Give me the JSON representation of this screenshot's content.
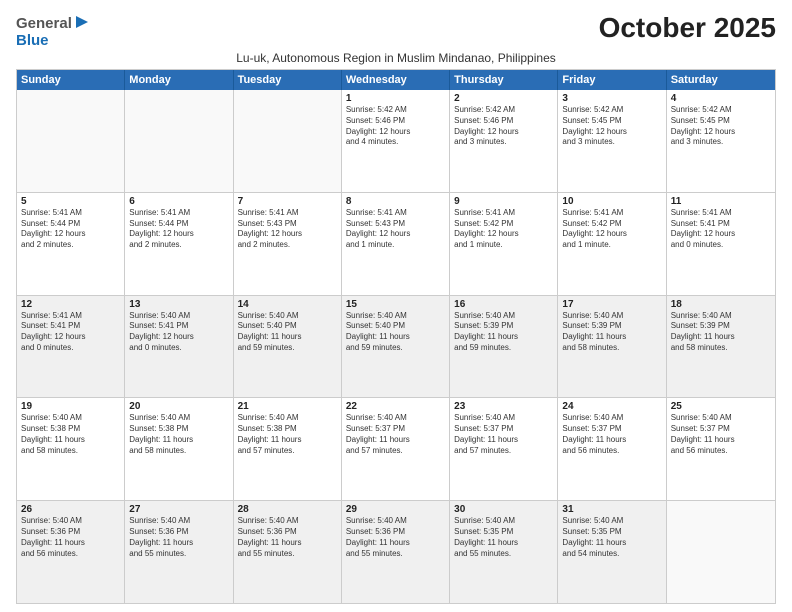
{
  "logo": {
    "general": "General",
    "blue": "Blue"
  },
  "title": "October 2025",
  "subtitle": "Lu-uk, Autonomous Region in Muslim Mindanao, Philippines",
  "days": [
    "Sunday",
    "Monday",
    "Tuesday",
    "Wednesday",
    "Thursday",
    "Friday",
    "Saturday"
  ],
  "rows": [
    [
      {
        "day": "",
        "lines": [],
        "empty": true
      },
      {
        "day": "",
        "lines": [],
        "empty": true
      },
      {
        "day": "",
        "lines": [],
        "empty": true
      },
      {
        "day": "1",
        "lines": [
          "Sunrise: 5:42 AM",
          "Sunset: 5:46 PM",
          "Daylight: 12 hours",
          "and 4 minutes."
        ]
      },
      {
        "day": "2",
        "lines": [
          "Sunrise: 5:42 AM",
          "Sunset: 5:46 PM",
          "Daylight: 12 hours",
          "and 3 minutes."
        ]
      },
      {
        "day": "3",
        "lines": [
          "Sunrise: 5:42 AM",
          "Sunset: 5:45 PM",
          "Daylight: 12 hours",
          "and 3 minutes."
        ]
      },
      {
        "day": "4",
        "lines": [
          "Sunrise: 5:42 AM",
          "Sunset: 5:45 PM",
          "Daylight: 12 hours",
          "and 3 minutes."
        ]
      }
    ],
    [
      {
        "day": "5",
        "lines": [
          "Sunrise: 5:41 AM",
          "Sunset: 5:44 PM",
          "Daylight: 12 hours",
          "and 2 minutes."
        ]
      },
      {
        "day": "6",
        "lines": [
          "Sunrise: 5:41 AM",
          "Sunset: 5:44 PM",
          "Daylight: 12 hours",
          "and 2 minutes."
        ]
      },
      {
        "day": "7",
        "lines": [
          "Sunrise: 5:41 AM",
          "Sunset: 5:43 PM",
          "Daylight: 12 hours",
          "and 2 minutes."
        ]
      },
      {
        "day": "8",
        "lines": [
          "Sunrise: 5:41 AM",
          "Sunset: 5:43 PM",
          "Daylight: 12 hours",
          "and 1 minute."
        ]
      },
      {
        "day": "9",
        "lines": [
          "Sunrise: 5:41 AM",
          "Sunset: 5:42 PM",
          "Daylight: 12 hours",
          "and 1 minute."
        ]
      },
      {
        "day": "10",
        "lines": [
          "Sunrise: 5:41 AM",
          "Sunset: 5:42 PM",
          "Daylight: 12 hours",
          "and 1 minute."
        ]
      },
      {
        "day": "11",
        "lines": [
          "Sunrise: 5:41 AM",
          "Sunset: 5:41 PM",
          "Daylight: 12 hours",
          "and 0 minutes."
        ]
      }
    ],
    [
      {
        "day": "12",
        "lines": [
          "Sunrise: 5:41 AM",
          "Sunset: 5:41 PM",
          "Daylight: 12 hours",
          "and 0 minutes."
        ],
        "shaded": true
      },
      {
        "day": "13",
        "lines": [
          "Sunrise: 5:40 AM",
          "Sunset: 5:41 PM",
          "Daylight: 12 hours",
          "and 0 minutes."
        ],
        "shaded": true
      },
      {
        "day": "14",
        "lines": [
          "Sunrise: 5:40 AM",
          "Sunset: 5:40 PM",
          "Daylight: 11 hours",
          "and 59 minutes."
        ],
        "shaded": true
      },
      {
        "day": "15",
        "lines": [
          "Sunrise: 5:40 AM",
          "Sunset: 5:40 PM",
          "Daylight: 11 hours",
          "and 59 minutes."
        ],
        "shaded": true
      },
      {
        "day": "16",
        "lines": [
          "Sunrise: 5:40 AM",
          "Sunset: 5:39 PM",
          "Daylight: 11 hours",
          "and 59 minutes."
        ],
        "shaded": true
      },
      {
        "day": "17",
        "lines": [
          "Sunrise: 5:40 AM",
          "Sunset: 5:39 PM",
          "Daylight: 11 hours",
          "and 58 minutes."
        ],
        "shaded": true
      },
      {
        "day": "18",
        "lines": [
          "Sunrise: 5:40 AM",
          "Sunset: 5:39 PM",
          "Daylight: 11 hours",
          "and 58 minutes."
        ],
        "shaded": true
      }
    ],
    [
      {
        "day": "19",
        "lines": [
          "Sunrise: 5:40 AM",
          "Sunset: 5:38 PM",
          "Daylight: 11 hours",
          "and 58 minutes."
        ]
      },
      {
        "day": "20",
        "lines": [
          "Sunrise: 5:40 AM",
          "Sunset: 5:38 PM",
          "Daylight: 11 hours",
          "and 58 minutes."
        ]
      },
      {
        "day": "21",
        "lines": [
          "Sunrise: 5:40 AM",
          "Sunset: 5:38 PM",
          "Daylight: 11 hours",
          "and 57 minutes."
        ]
      },
      {
        "day": "22",
        "lines": [
          "Sunrise: 5:40 AM",
          "Sunset: 5:37 PM",
          "Daylight: 11 hours",
          "and 57 minutes."
        ]
      },
      {
        "day": "23",
        "lines": [
          "Sunrise: 5:40 AM",
          "Sunset: 5:37 PM",
          "Daylight: 11 hours",
          "and 57 minutes."
        ]
      },
      {
        "day": "24",
        "lines": [
          "Sunrise: 5:40 AM",
          "Sunset: 5:37 PM",
          "Daylight: 11 hours",
          "and 56 minutes."
        ]
      },
      {
        "day": "25",
        "lines": [
          "Sunrise: 5:40 AM",
          "Sunset: 5:37 PM",
          "Daylight: 11 hours",
          "and 56 minutes."
        ]
      }
    ],
    [
      {
        "day": "26",
        "lines": [
          "Sunrise: 5:40 AM",
          "Sunset: 5:36 PM",
          "Daylight: 11 hours",
          "and 56 minutes."
        ],
        "shaded": true
      },
      {
        "day": "27",
        "lines": [
          "Sunrise: 5:40 AM",
          "Sunset: 5:36 PM",
          "Daylight: 11 hours",
          "and 55 minutes."
        ],
        "shaded": true
      },
      {
        "day": "28",
        "lines": [
          "Sunrise: 5:40 AM",
          "Sunset: 5:36 PM",
          "Daylight: 11 hours",
          "and 55 minutes."
        ],
        "shaded": true
      },
      {
        "day": "29",
        "lines": [
          "Sunrise: 5:40 AM",
          "Sunset: 5:36 PM",
          "Daylight: 11 hours",
          "and 55 minutes."
        ],
        "shaded": true
      },
      {
        "day": "30",
        "lines": [
          "Sunrise: 5:40 AM",
          "Sunset: 5:35 PM",
          "Daylight: 11 hours",
          "and 55 minutes."
        ],
        "shaded": true
      },
      {
        "day": "31",
        "lines": [
          "Sunrise: 5:40 AM",
          "Sunset: 5:35 PM",
          "Daylight: 11 hours",
          "and 54 minutes."
        ],
        "shaded": true
      },
      {
        "day": "",
        "lines": [],
        "empty": true,
        "shaded": true
      }
    ]
  ]
}
